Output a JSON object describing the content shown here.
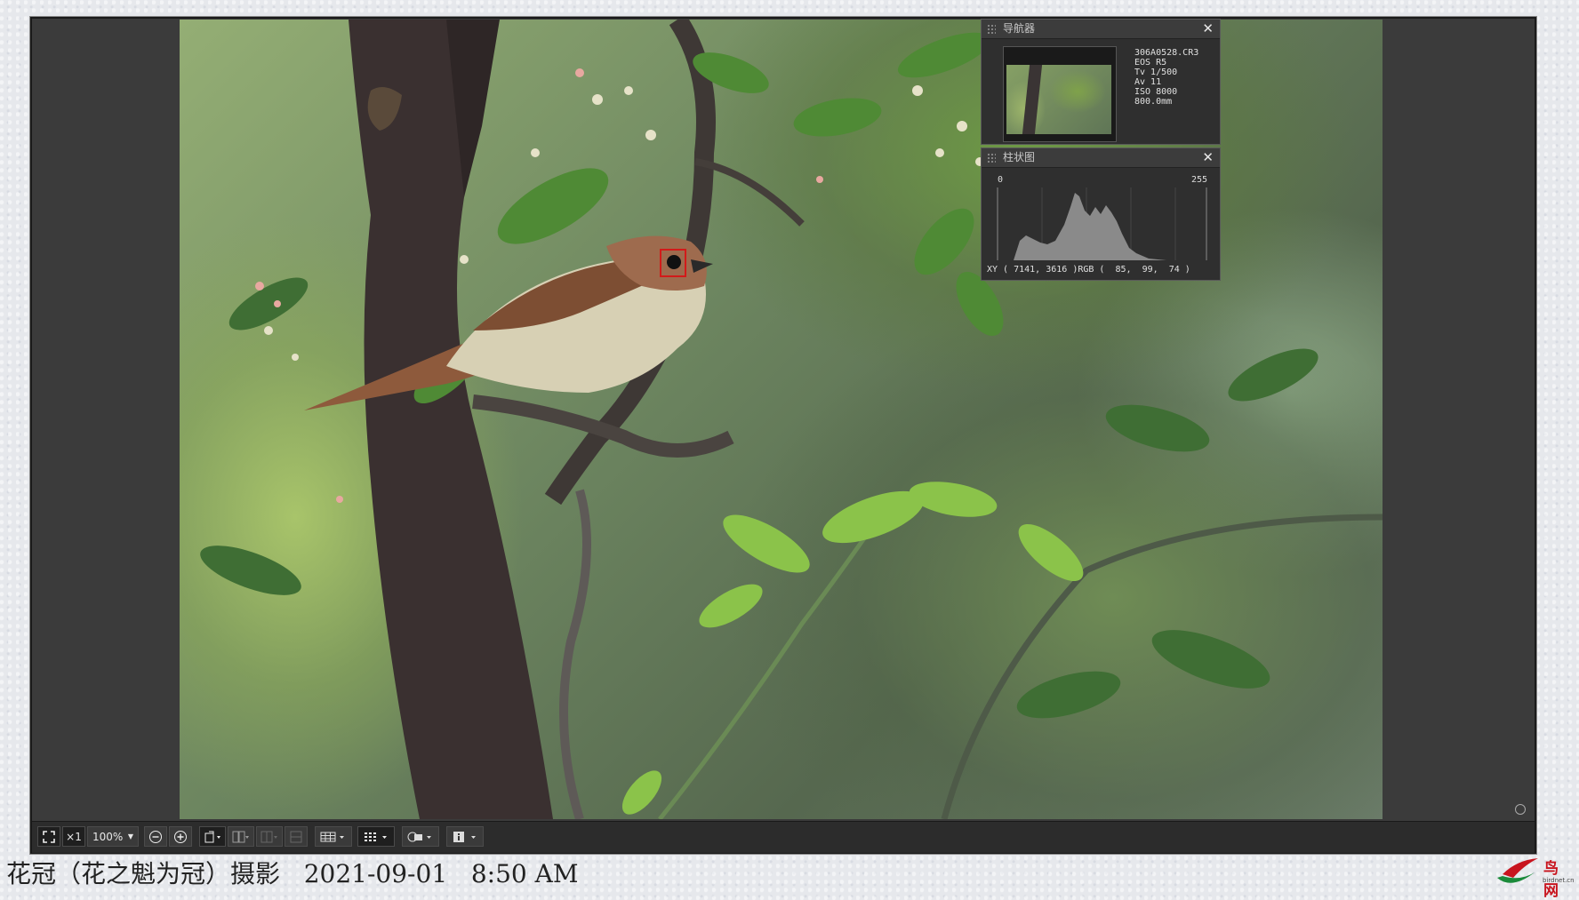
{
  "navigator": {
    "title": "导航器",
    "close": "✕",
    "info": {
      "filename": "306A0528.CR3",
      "camera": "EOS R5",
      "tv": "Tv 1/500",
      "av": "Av 11",
      "iso": "ISO 8000",
      "focal": "800.0mm"
    }
  },
  "histogram": {
    "title": "柱状图",
    "close": "✕",
    "scale_min": "0",
    "scale_max": "255",
    "readout": "XY ( 7141, 3616 )RGB (  85,  99,  74 )"
  },
  "toolbar": {
    "fit_icon": "fit-screen-icon",
    "zoom_x1": "×1",
    "zoom_level": "100%",
    "zoom_out_icon": "zoom-out-icon",
    "zoom_in_icon": "zoom-in-icon",
    "info_icon": "info-icon"
  },
  "caption": "花冠（花之魁为冠）摄影   2021-09-01   8:50 AM",
  "logo": {
    "text": "鸟网",
    "sub": "birdnet.cn"
  },
  "colors": {
    "panel_bg": "#2f2f2f",
    "toolbar_bg": "#2c2c2c",
    "focus_box": "#d21a1a"
  }
}
